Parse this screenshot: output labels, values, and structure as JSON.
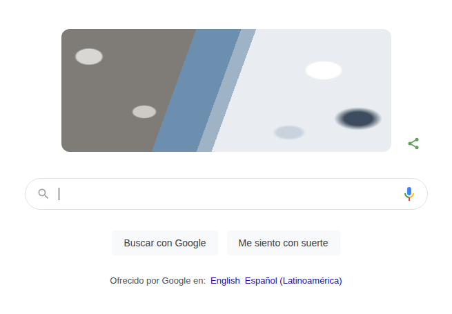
{
  "search": {
    "value": "",
    "focused": true
  },
  "buttons": [
    {
      "label": "Buscar con Google"
    },
    {
      "label": "Me siento con suerte"
    }
  ],
  "language_bar": {
    "label": "Ofrecido por Google en:",
    "links": [
      "English",
      "Español (Latinoamérica)"
    ]
  }
}
